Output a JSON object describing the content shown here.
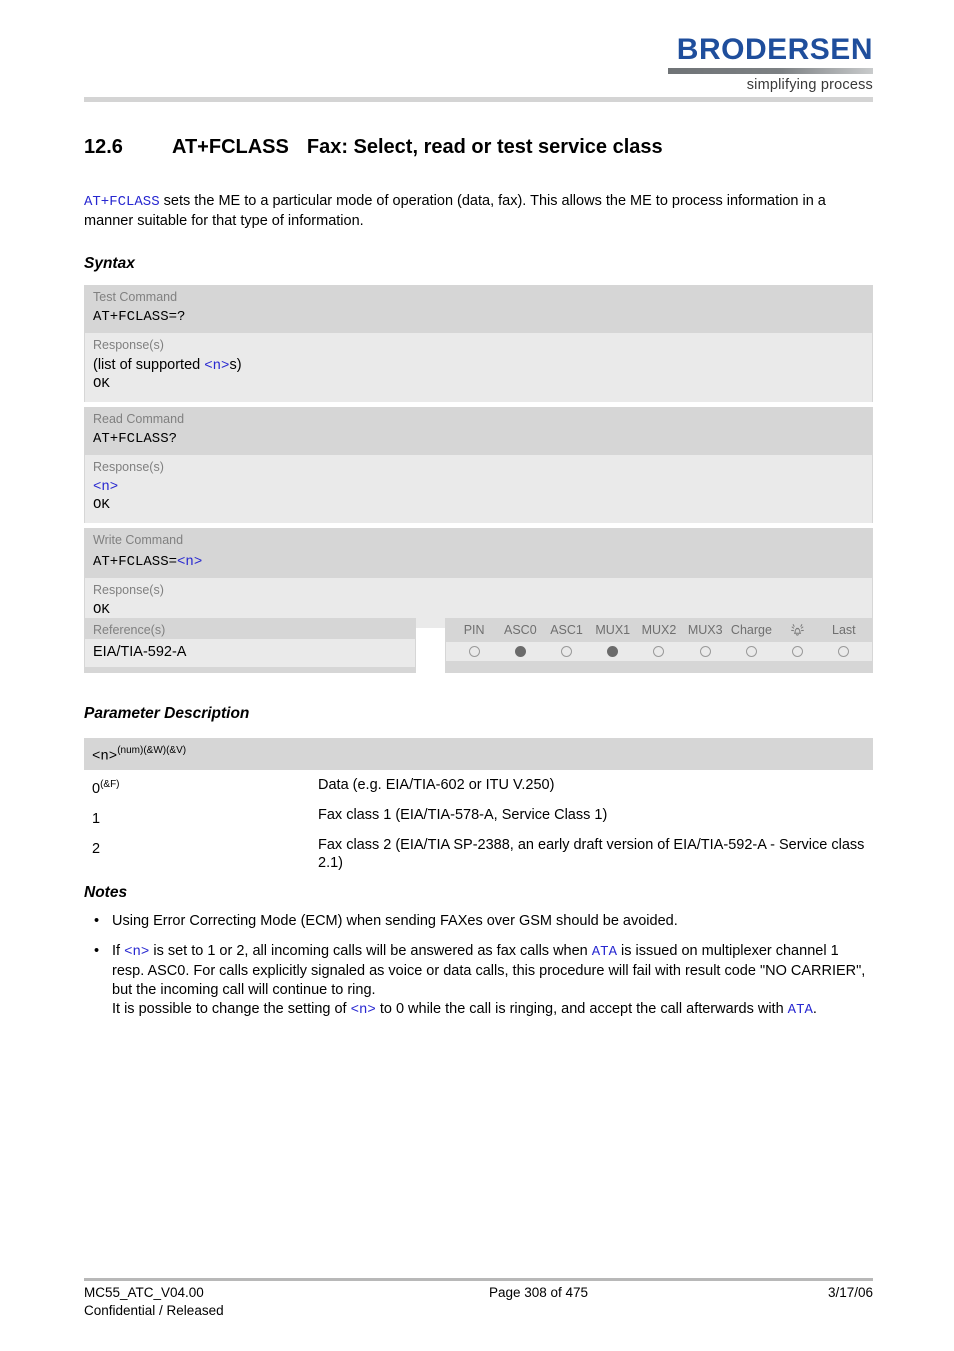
{
  "header": {
    "logo_word": "BRODERSEN",
    "logo_tagline": "simplifying process",
    "logo_color": "#1f4e9c"
  },
  "heading": {
    "number": "12.6",
    "command": "AT+FCLASS",
    "title": "Fax: Select, read or test service class"
  },
  "intro": {
    "command": "AT+FCLASS",
    "text": " sets the ME to a particular mode of operation (data, fax). This allows the ME to process information in a manner suitable for that type of information."
  },
  "sections": {
    "syntax": "Syntax",
    "parameter_description": "Parameter Description",
    "notes": "Notes"
  },
  "syntax": {
    "test": {
      "label": "Test Command",
      "command": "AT+FCLASS=?",
      "response_label": "Response(s)",
      "response_prefix": "(list of supported ",
      "response_param": "<n>",
      "response_suffix": "s)",
      "response_ok": "OK"
    },
    "read": {
      "label": "Read Command",
      "command": "AT+FCLASS?",
      "response_label": "Response(s)",
      "response_param": "<n>",
      "response_ok": "OK"
    },
    "write": {
      "label": "Write Command",
      "command_prefix": "AT+FCLASS=",
      "command_param": "<n>",
      "response_label": "Response(s)",
      "response_ok": "OK"
    },
    "reference": {
      "label": "Reference(s)",
      "value": "EIA/TIA-592-A"
    },
    "indicators": {
      "columns": [
        "PIN",
        "ASC0",
        "ASC1",
        "MUX1",
        "MUX2",
        "MUX3",
        "Charge",
        "alarm-icon",
        "Last"
      ],
      "states": [
        false,
        true,
        false,
        true,
        false,
        false,
        false,
        false,
        false
      ]
    }
  },
  "parameters": {
    "header_name": "<n>",
    "header_sup": "(num)(&W)(&V)",
    "rows": [
      {
        "key": "0",
        "key_sup": "(&F)",
        "value": "Data (e.g. EIA/TIA-602 or ITU V.250)"
      },
      {
        "key": "1",
        "key_sup": "",
        "value": "Fax class 1 (EIA/TIA-578-A, Service Class 1)"
      },
      {
        "key": "2",
        "key_sup": "",
        "value": "Fax class 2 (EIA/TIA SP-2388, an early draft version of EIA/TIA-592-A - Service class 2.1)"
      }
    ]
  },
  "notes": {
    "bullet": "•",
    "items": [
      {
        "p1": "Using Error Correcting Mode (ECM) when sending FAXes over GSM should be avoided."
      },
      {
        "a": "If ",
        "param1": "<n>",
        "b": " is set to 1 or 2, all incoming calls will be answered as fax calls when ",
        "cmd1": "ATA",
        "c": " is issued on multiplexer channel 1 resp. ASC0. For calls explicitly signaled as voice or data calls, this procedure will fail with result code \"NO CARRIER\", but the incoming call will continue to ring.",
        "d": "It is possible to change the setting of ",
        "param2": "<n>",
        "e": " to 0 while the call is ringing, and accept the call afterwards with ",
        "cmd2": "ATA",
        "f": "."
      }
    ]
  },
  "footer": {
    "doc": "MC55_ATC_V04.00",
    "classification": "Confidential / Released",
    "page": "Page 308 of 475",
    "date": "3/17/06"
  }
}
